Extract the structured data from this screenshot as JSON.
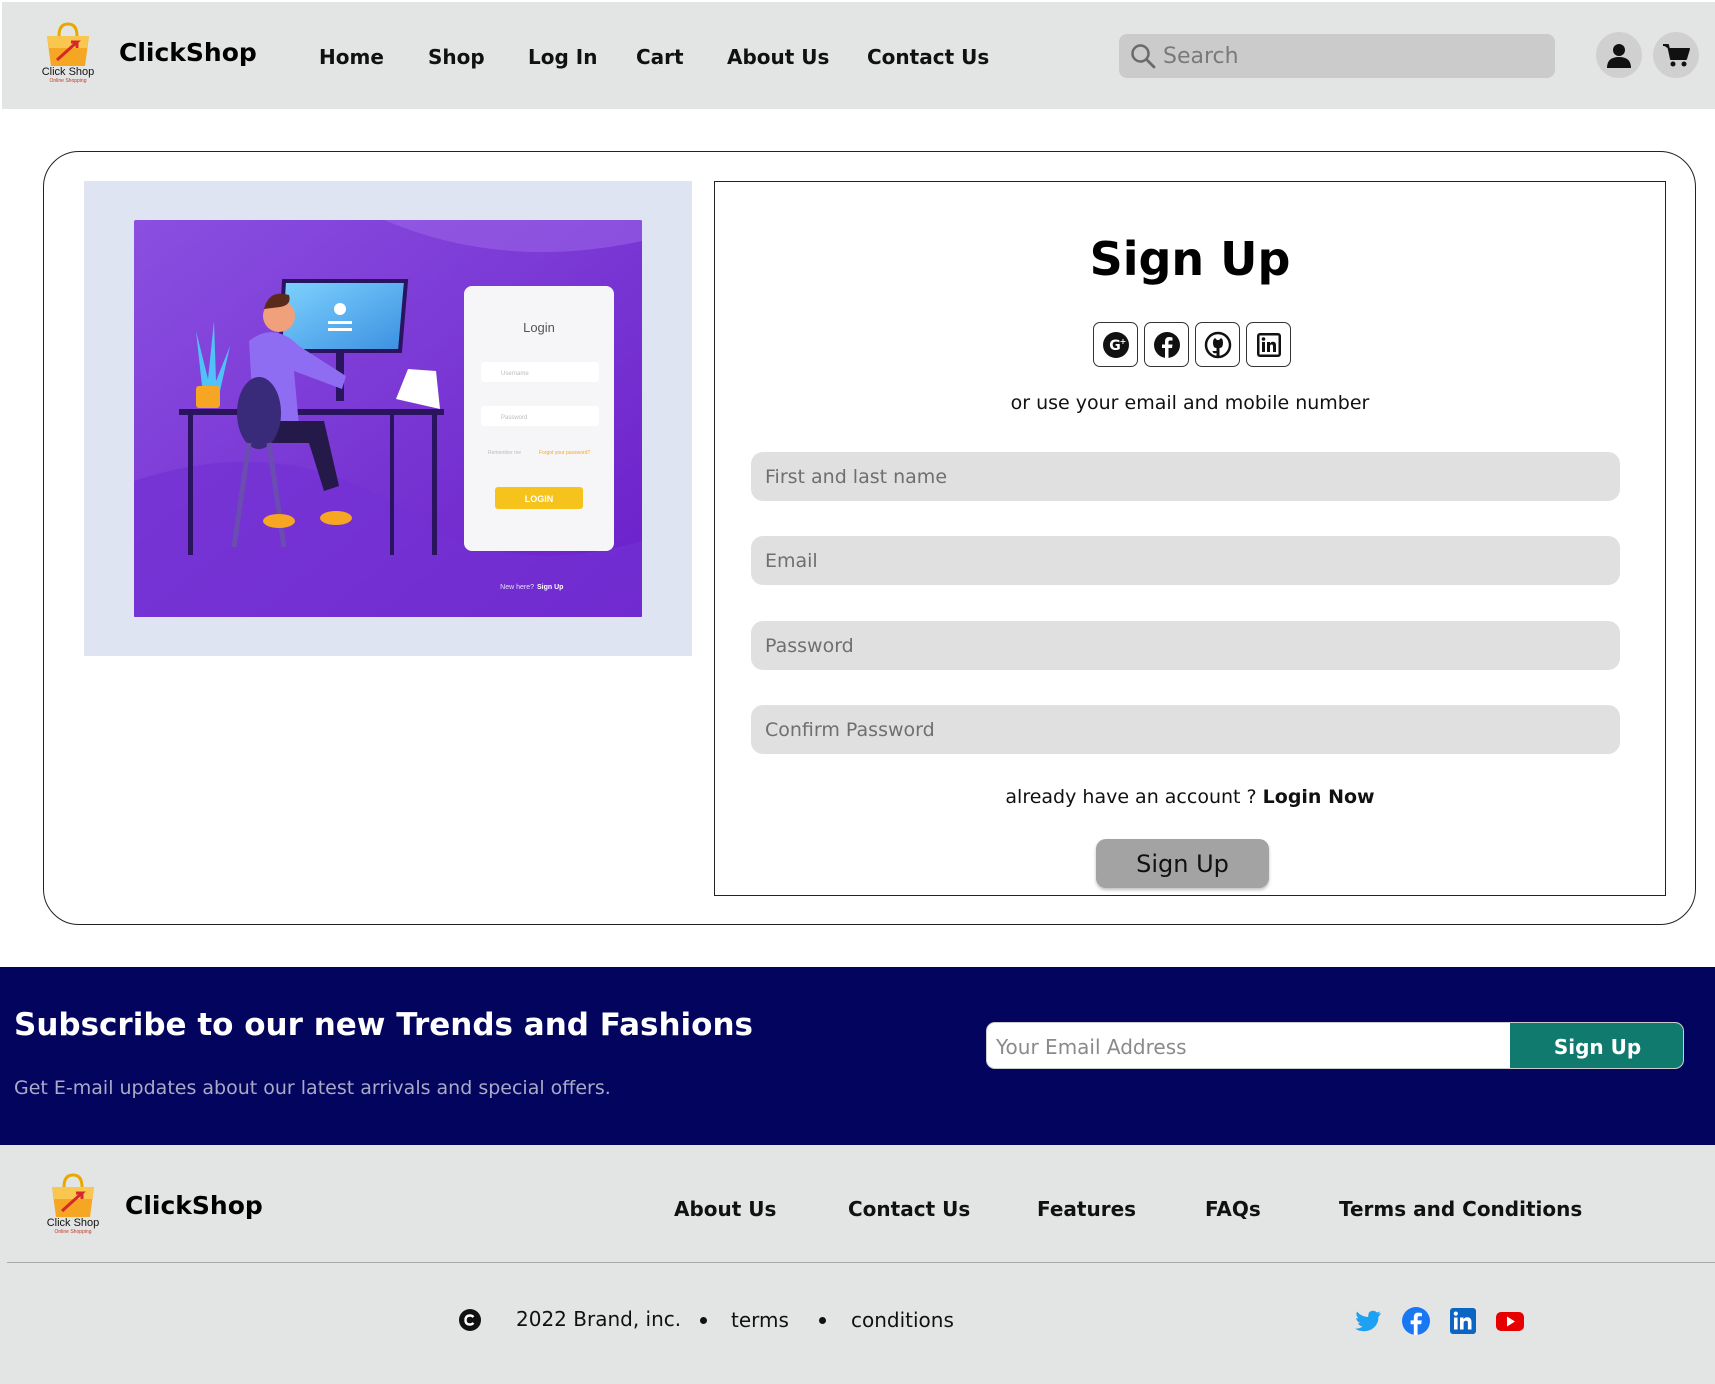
{
  "header": {
    "logo_text": "Click Shop",
    "logo_subtext": "Online Shopping",
    "brand": "ClickShop",
    "nav": [
      "Home",
      "Shop",
      "Log In",
      "Cart",
      "About Us",
      "Contact Us"
    ],
    "search_placeholder": "Search"
  },
  "illustration": {
    "login_title": "Login",
    "username_placeholder": "Username",
    "password_placeholder": "Password",
    "remember": "Remember me",
    "forgot": "Forgot your password?",
    "login_button": "LOGIN",
    "new_here": "New here?",
    "sign_up_link": "Sign Up"
  },
  "signup": {
    "title": "Sign Up",
    "social_icons": [
      "google-plus",
      "facebook",
      "github",
      "linkedin"
    ],
    "alt_text": "or use your email and mobile number",
    "fields": {
      "name_placeholder": "First and last name",
      "email_placeholder": "Email",
      "password_placeholder": "Password",
      "confirm_placeholder": "Confirm Password"
    },
    "have_account": "already have an account ?",
    "login_now": "Login Now",
    "button": "Sign Up"
  },
  "newsletter": {
    "title": "Subscribe to our new Trends and Fashions",
    "subtitle": "Get E-mail updates about our latest arrivals and special offers.",
    "email_placeholder": "Your Email Address",
    "button": "Sign Up"
  },
  "footer": {
    "logo_text": "Click Shop",
    "logo_subtext": "Online Shopping",
    "brand": "ClickShop",
    "links": [
      "About Us",
      "Contact Us",
      "Features",
      "FAQs",
      "Terms and Conditions"
    ],
    "copyright": "2022 Brand, inc.",
    "terms": "terms",
    "conditions": "conditions",
    "social_icons": [
      "twitter",
      "facebook",
      "linkedin",
      "youtube"
    ]
  },
  "colors": {
    "header_bg": "#e3e5e4",
    "newsletter_bg": "#03045e",
    "newsletter_button": "#117a6e",
    "field_bg": "#e0e0e0",
    "signup_button": "#a3a3a3",
    "illustration_purple": "#7b3fd6"
  }
}
